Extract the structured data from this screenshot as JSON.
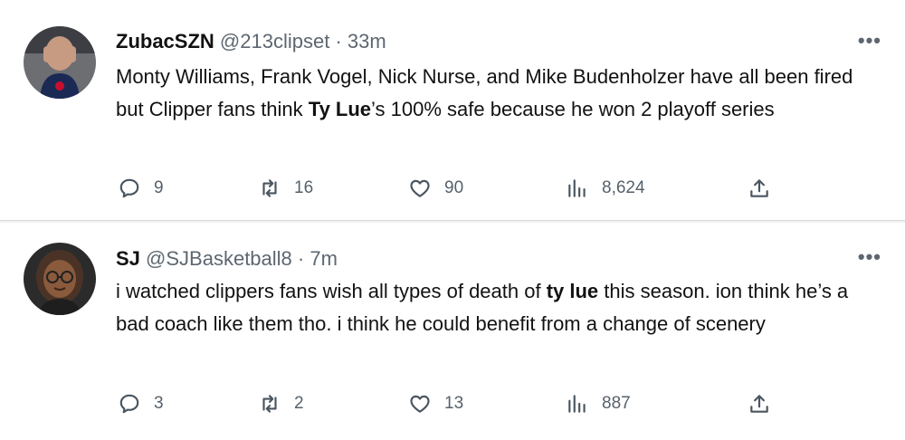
{
  "tweets": [
    {
      "name": "ZubacSZN",
      "handle": "@213clipset",
      "time": "33m",
      "text_before": "Monty Williams, Frank Vogel, Nick Nurse, and Mike Budenholzer have all been fired but Clipper fans think ",
      "text_bold": "Ty Lue",
      "text_after": "’s 100% safe because he won 2 playoff series",
      "replies": "9",
      "retweets": "16",
      "likes": "90",
      "views": "8,624"
    },
    {
      "name": "SJ",
      "handle": "@SJBasketball8",
      "time": "7m",
      "text_before": "i watched clippers fans wish all types of death of ",
      "text_bold": "ty lue",
      "text_after": " this season. ion think he’s a bad coach like them tho. i think he could benefit from a change of scenery",
      "replies": "3",
      "retweets": "2",
      "likes": "13",
      "views": "887"
    }
  ],
  "more_label": "•••",
  "sep": "·",
  "colors": {
    "text": "#121212",
    "muted": "#5e6770",
    "icon": "#56616b"
  }
}
